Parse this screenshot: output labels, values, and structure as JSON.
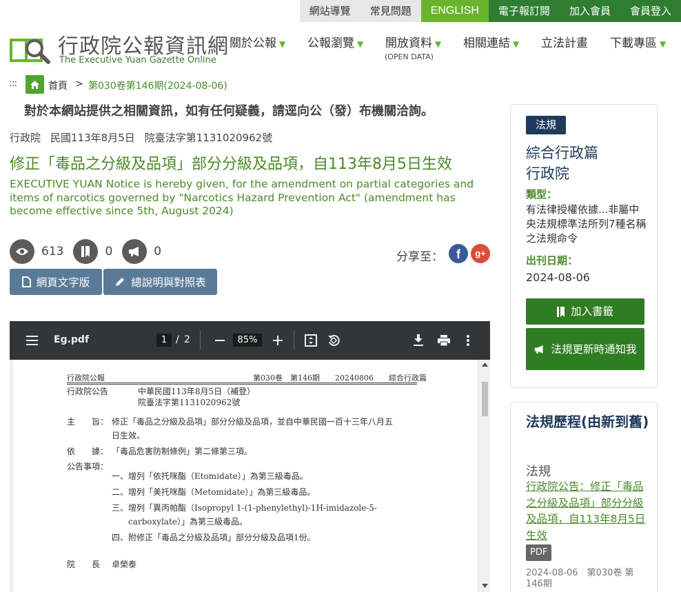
{
  "topbar": {
    "items": [
      "網站導覽",
      "常見問題",
      "ENGLISH",
      "電子報訂閱",
      "加入會員",
      "會員登入"
    ]
  },
  "brand": {
    "name_cn": "行政院公報資訊網",
    "name_en": "The Executive Yuan Gazette Online"
  },
  "nav": {
    "items": [
      "關於公報",
      "公報瀏覽",
      "開放資料",
      "相關連結",
      "立法計畫",
      "下載專區"
    ],
    "open_data_sub": "(OPEN DATA)"
  },
  "breadcrumb": {
    "home": "首頁",
    "separator": ">",
    "current": "第030卷第146期(2024-08-06)"
  },
  "disclaimer": "對於本網站提供之相關資訊，如有任何疑義，請逕向公（發）布機關洽詢。",
  "meta": {
    "agency": "行政院",
    "date": "民國113年8月5日",
    "doc_no": "院臺法字第1131020962號"
  },
  "title_cn": "修正「毒品之分級及品項」部分分級及品項，自113年8月5日生效",
  "title_en": "EXECUTIVE YUAN Notice is hereby given, for the amendment on partial categories and items of narcotics governed by \"Narcotics Hazard Prevention Act\" (amendment has become effective since 5th, August 2024)",
  "stats": {
    "views": "613",
    "bookmarks": "0",
    "notices": "0"
  },
  "share": {
    "label": "分享至：",
    "facebook": "f",
    "google": "g+"
  },
  "buttons": {
    "text_version": "網頁文字版",
    "explanation": "總說明與對照表"
  },
  "pdf": {
    "filename": "Eg.pdf",
    "page_current": "1",
    "page_sep": "/",
    "page_total": "2",
    "zoom": "85%",
    "header_left": "行政院公報",
    "header_right": "第030卷　第146期　　20240806　　綜合行政篇",
    "notice_label": "行政院公告",
    "notice_date": "中華民國113年8月5日（補登）",
    "notice_no": "院臺法字第1131020962號",
    "subject_label": "主　　旨：",
    "subject_line1": "修正「毒品之分級及品項」部分分級及品項，並自中華民國一百十三年八月五",
    "subject_line2": "日生效。",
    "basis_label": "依　　據：",
    "basis_text": "「毒品危害防制條例」第二條第三項。",
    "items_label": "公告事項：",
    "item1": "一、增列「依托咪酯（Etomidate）」為第三級毒品。",
    "item2": "二、增列「美托咪酯（Metomidate）」為第三級毒品。",
    "item3a": "三、增列「異丙帕酯（Isopropyl 1-(1-phenylethyl)-1H-imidazole-5-",
    "item3b": "carboxylate）」為第三級毒品。",
    "item4": "四、附修正「毒品之分級及品項」部分分級及品項1份。",
    "sign_label": "院　　長",
    "sign_name": "卓榮泰"
  },
  "sidebar": {
    "badge": "法規",
    "heading1": "綜合行政篇",
    "heading2": "行政院",
    "type_label": "類型：",
    "type_text": "有法律授權依據...非屬中央法規標準法所列7種名稱之法規命令",
    "date_label": "出刊日期：",
    "date_value": "2024-08-06",
    "bookmark_btn": "加入書籤",
    "notify_btn": "法規更新時通知我",
    "history_title": "法規歷程(由新到舊)",
    "history_category": "法規",
    "history_link": "行政院公告：修正「毒品之分級及品項」部分分級及品項，自113年8月5日生效",
    "history_tag": "PDF",
    "history_meta": "2024-08-06　第030卷 第146期"
  }
}
